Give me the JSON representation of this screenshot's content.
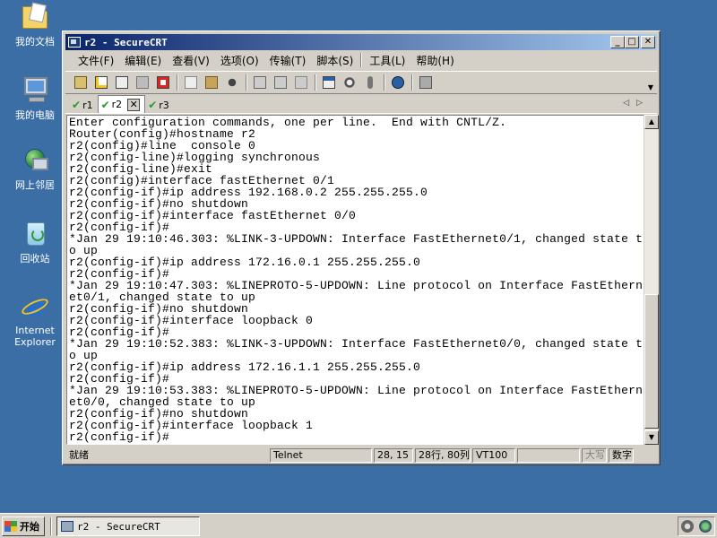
{
  "desktop": {
    "icons": [
      {
        "label": "我的文档",
        "icon": "my-documents-icon"
      },
      {
        "label": "我的电脑",
        "icon": "my-computer-icon"
      },
      {
        "label": "网上邻居",
        "icon": "network-places-icon"
      },
      {
        "label": "回收站",
        "icon": "recycle-bin-icon"
      },
      {
        "label": "Internet Explorer",
        "icon": "internet-explorer-icon"
      }
    ]
  },
  "window": {
    "title": "r2 - SecureCRT",
    "controls": {
      "minimize": "_",
      "maximize": "□",
      "close": "✕"
    }
  },
  "menu": [
    "文件(F)",
    "编辑(E)",
    "查看(V)",
    "选项(O)",
    "传输(T)",
    "脚本(S)",
    "工具(L)",
    "帮助(H)"
  ],
  "toolbar": {
    "icons": [
      "connect-icon",
      "quick-connect-icon",
      "connect-in-tab-icon",
      "reconnect-icon",
      "disconnect-icon",
      "copy-icon",
      "paste-icon",
      "find-icon",
      "print-icon",
      "print-selection-icon",
      "print-setup-icon",
      "session-options-icon",
      "global-options-icon",
      "keymap-icon",
      "help-icon",
      "sftp-icon"
    ]
  },
  "tabs": [
    {
      "label": "r1",
      "active": false
    },
    {
      "label": "r2",
      "active": true
    },
    {
      "label": "r3",
      "active": false
    }
  ],
  "terminal": {
    "lines": [
      "Enter configuration commands, one per line.  End with CNTL/Z.",
      "Router(config)#hostname r2",
      "r2(config)#line  console 0",
      "r2(config-line)#logging synchronous",
      "r2(config-line)#exit",
      "r2(config)#interface fastEthernet 0/1",
      "r2(config-if)#ip address 192.168.0.2 255.255.255.0",
      "r2(config-if)#no shutdown",
      "r2(config-if)#interface fastEthernet 0/0",
      "r2(config-if)#",
      "*Jan 29 19:10:46.303: %LINK-3-UPDOWN: Interface FastEthernet0/1, changed state t",
      "o up",
      "r2(config-if)#ip address 172.16.0.1 255.255.255.0",
      "r2(config-if)#",
      "*Jan 29 19:10:47.303: %LINEPROTO-5-UPDOWN: Line protocol on Interface FastEthern",
      "et0/1, changed state to up",
      "r2(config-if)#no shutdown",
      "r2(config-if)#interface loopback 0",
      "r2(config-if)#",
      "*Jan 29 19:10:52.383: %LINK-3-UPDOWN: Interface FastEthernet0/0, changed state t",
      "o up",
      "r2(config-if)#ip address 172.16.1.1 255.255.255.0",
      "r2(config-if)#",
      "*Jan 29 19:10:53.383: %LINEPROTO-5-UPDOWN: Line protocol on Interface FastEthern",
      "et0/0, changed state to up",
      "r2(config-if)#no shutdown",
      "r2(config-if)#interface loopback 1",
      "r2(config-if)#"
    ]
  },
  "status": {
    "ready": "就绪",
    "protocol": "Telnet",
    "cursor": "28, 15",
    "size": "28行, 80列",
    "emulation": "VT100",
    "blank": "",
    "caps": "大写",
    "num": "数字"
  },
  "taskbar": {
    "start": "开始",
    "task": "r2 - SecureCRT"
  },
  "colors": {
    "desktop": "#3a6ea5",
    "title_active_start": "#0a246a",
    "title_active_end": "#a6caf0",
    "tab_check": "#2a9a2a"
  }
}
